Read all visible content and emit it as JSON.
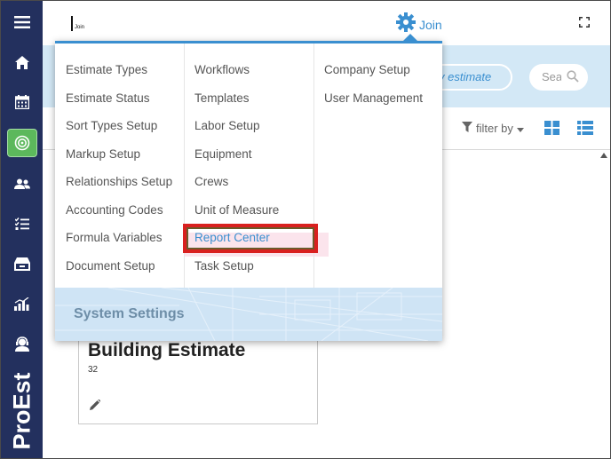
{
  "app": {
    "brand": "ProEst",
    "logo_text": "Join",
    "header_menu_label": "Join"
  },
  "sidebar": {
    "items": [
      {
        "name": "menu",
        "icon": "hamburger-icon"
      },
      {
        "name": "home",
        "icon": "home-icon"
      },
      {
        "name": "calendar",
        "icon": "calendar-icon"
      },
      {
        "name": "estimates",
        "icon": "target-icon",
        "active": true
      },
      {
        "name": "users",
        "icon": "users-icon"
      },
      {
        "name": "tasks",
        "icon": "checklist-icon"
      },
      {
        "name": "inventory",
        "icon": "drawer-icon"
      },
      {
        "name": "reports",
        "icon": "chart-icon"
      },
      {
        "name": "support",
        "icon": "support-icon"
      }
    ]
  },
  "toolbar": {
    "new_estimate": "v estimate",
    "search_placeholder": "Sea",
    "filter_label": "filter by"
  },
  "card": {
    "title": "Building Estimate",
    "number": "32"
  },
  "menu": {
    "col1": [
      "Estimate Types",
      "Estimate Status",
      "Sort Types Setup",
      "Markup Setup",
      "Relationships Setup",
      "Accounting Codes",
      "Formula Variables",
      "Document Setup"
    ],
    "col2": [
      "Workflows",
      "Templates",
      "Labor Setup",
      "Equipment",
      "Crews",
      "Unit of Measure",
      "Report Center",
      "Task Setup"
    ],
    "col3": [
      "Company Setup",
      "User Management"
    ],
    "highlighted": "Report Center",
    "footer_title": "System Settings"
  },
  "colors": {
    "sidebar_bg": "#23305e",
    "accent": "#3a8fd0",
    "active_green": "#5cb85c",
    "highlight_border": "#d9201f"
  }
}
